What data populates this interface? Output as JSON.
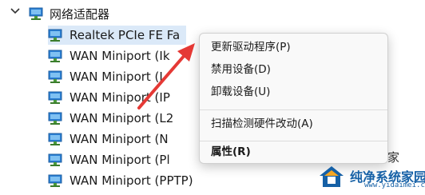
{
  "tree": {
    "category": {
      "label": "网络适配器",
      "expanded": true
    },
    "devices": [
      {
        "label": "Realtek PCIe FE Fa",
        "selected": true
      },
      {
        "label": "WAN Miniport (Ik"
      },
      {
        "label": "WAN Miniport (I"
      },
      {
        "label": "WAN Miniport (IP"
      },
      {
        "label": "WAN Miniport (L2"
      },
      {
        "label": "WAN Miniport (N"
      },
      {
        "label": "WAN Miniport (Pl"
      },
      {
        "label": "WAN Miniport (PPTP)"
      }
    ],
    "partial_behind_text": "系统之家"
  },
  "context_menu": {
    "items": [
      {
        "label": "更新驱动程序(P)"
      },
      {
        "label": "禁用设备(D)"
      },
      {
        "label": "卸载设备(U)"
      },
      {
        "label": "扫描检测硬件改动(A)"
      },
      {
        "label": "属性(R)",
        "bold": true
      }
    ]
  },
  "watermark": {
    "title": "纯净系统家园",
    "url": "www.yidaimei.com",
    "colors": {
      "primary": "#1560a6",
      "accent": "#f5a623"
    }
  },
  "colors": {
    "selection": "#dbe9f8",
    "arrow": "#e53935",
    "menu_bg": "#f9f9f9"
  }
}
